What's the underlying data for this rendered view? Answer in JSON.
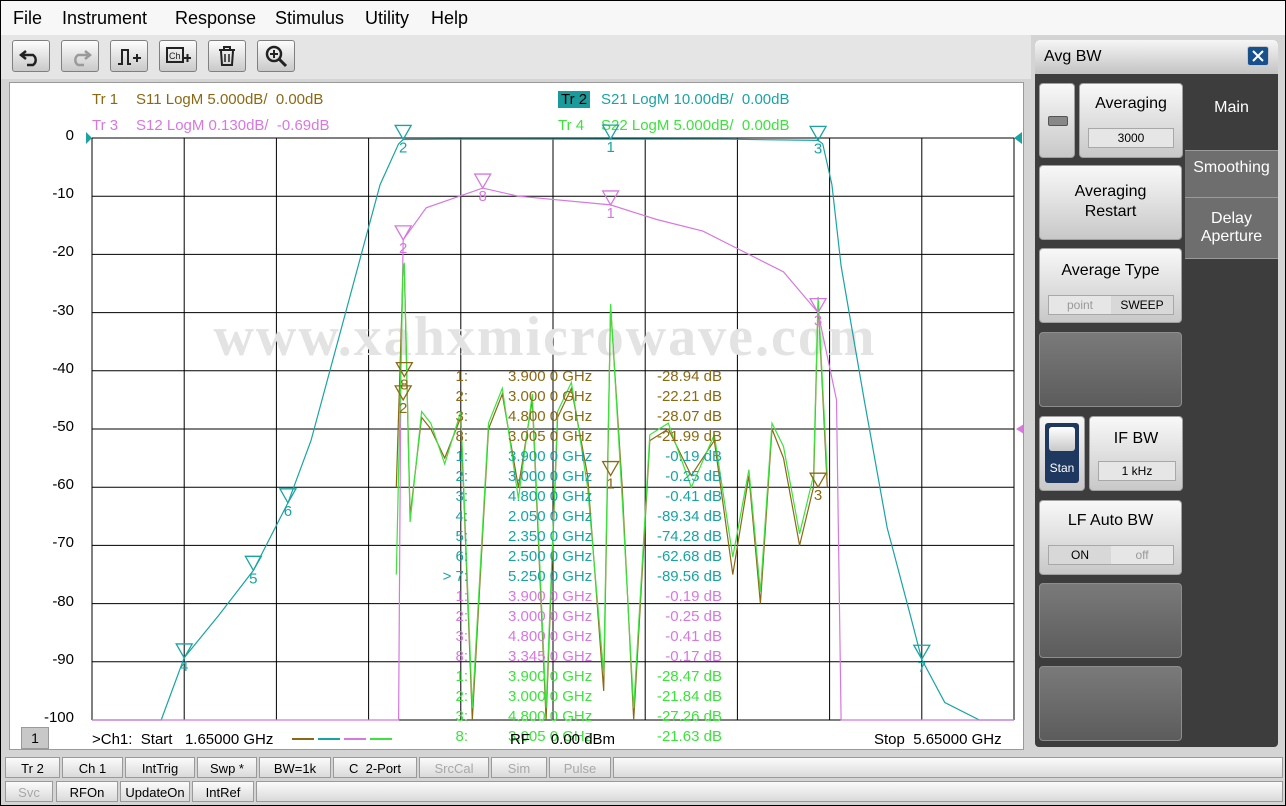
{
  "menu": [
    "File",
    "Instrument",
    "Response",
    "Stimulus",
    "Utility",
    "Help"
  ],
  "toolbar_icons": [
    "undo-icon",
    "redo-icon",
    "add-trace-icon",
    "add-channel-icon",
    "delete-icon",
    "zoom-icon"
  ],
  "traces": [
    {
      "tr": "Tr 1",
      "text": "S11 LogM 5.000dB/  0.00dB",
      "color": "#8b6914"
    },
    {
      "tr": "Tr 2",
      "text": "S21 LogM 10.00dB/  0.00dB",
      "color": "#1aa3a3",
      "active": true
    },
    {
      "tr": "Tr 3",
      "text": "S12 LogM 0.130dB/  -0.69dB",
      "color": "#d678e0"
    },
    {
      "tr": "Tr 4",
      "text": "S22 LogM 5.000dB/  0.00dB",
      "color": "#3de23d"
    }
  ],
  "y_ticks": [
    "0",
    "-10",
    "-20",
    "-30",
    "-40",
    "-50",
    "-60",
    "-70",
    "-80",
    "-90",
    "-100"
  ],
  "watermark": "www.xahxmicrowave.com",
  "marker_table": [
    {
      "n": "1:",
      "f": "3.900 0 GHz",
      "v": "-28.94 dB",
      "c": "#8b6914"
    },
    {
      "n": "2:",
      "f": "3.000 0 GHz",
      "v": "-22.21 dB",
      "c": "#8b6914"
    },
    {
      "n": "3:",
      "f": "4.800 0 GHz",
      "v": "-28.07 dB",
      "c": "#8b6914"
    },
    {
      "n": "8:",
      "f": "3.005 0 GHz",
      "v": "-21.99 dB",
      "c": "#8b6914"
    },
    {
      "n": "1:",
      "f": "3.900 0 GHz",
      "v": "-0.19 dB",
      "c": "#1aa3a3"
    },
    {
      "n": "2:",
      "f": "3.000 0 GHz",
      "v": "-0.25 dB",
      "c": "#1aa3a3"
    },
    {
      "n": "3:",
      "f": "4.800 0 GHz",
      "v": "-0.41 dB",
      "c": "#1aa3a3"
    },
    {
      "n": "4:",
      "f": "2.050 0 GHz",
      "v": "-89.34 dB",
      "c": "#1aa3a3"
    },
    {
      "n": "5:",
      "f": "2.350 0 GHz",
      "v": "-74.28 dB",
      "c": "#1aa3a3"
    },
    {
      "n": "6:",
      "f": "2.500 0 GHz",
      "v": "-62.68 dB",
      "c": "#1aa3a3"
    },
    {
      "n": "> 7:",
      "f": "5.250 0 GHz",
      "v": "-89.56 dB",
      "c": "#1aa3a3"
    },
    {
      "n": "1:",
      "f": "3.900 0 GHz",
      "v": "-0.19 dB",
      "c": "#d678e0"
    },
    {
      "n": "2:",
      "f": "3.000 0 GHz",
      "v": "-0.25 dB",
      "c": "#d678e0"
    },
    {
      "n": "3:",
      "f": "4.800 0 GHz",
      "v": "-0.41 dB",
      "c": "#d678e0"
    },
    {
      "n": "8:",
      "f": "3.345 0 GHz",
      "v": "-0.17 dB",
      "c": "#d678e0"
    },
    {
      "n": "1:",
      "f": "3.900 0 GHz",
      "v": "-28.47 dB",
      "c": "#3de23d"
    },
    {
      "n": "2:",
      "f": "3.000 0 GHz",
      "v": "-21.84 dB",
      "c": "#3de23d"
    },
    {
      "n": "3:",
      "f": "4.800 0 GHz",
      "v": "-27.26 dB",
      "c": "#3de23d"
    },
    {
      "n": "8:",
      "f": "3.005 0 GHz",
      "v": "-21.63 dB",
      "c": "#3de23d"
    }
  ],
  "footer": {
    "channel_number": "1",
    "start": ">Ch1:  Start   1.65000 GHz",
    "power": "RF     0.00 dBm",
    "stop": "Stop  5.65000 GHz"
  },
  "status_row1": [
    {
      "label": "Tr 2",
      "dim": false
    },
    {
      "label": "Ch 1",
      "dim": false
    },
    {
      "label": "IntTrig",
      "dim": false
    },
    {
      "label": "Swp *",
      "dim": false
    },
    {
      "label": "BW=1k",
      "dim": false
    },
    {
      "label": "C  2-Port",
      "dim": false
    },
    {
      "label": "SrcCal",
      "dim": true
    },
    {
      "label": "Sim",
      "dim": true
    },
    {
      "label": "Pulse",
      "dim": true
    }
  ],
  "status_row2": [
    {
      "label": "Svc",
      "dim": true
    },
    {
      "label": "RFOn",
      "dim": false
    },
    {
      "label": "UpdateOn",
      "dim": false
    },
    {
      "label": "IntRef",
      "dim": false
    }
  ],
  "softkeys": {
    "title": "Avg BW",
    "averaging_label": "Averaging",
    "averaging_value": "3000",
    "restart_label": "Averaging Restart",
    "avg_type_label": "Average Type",
    "avg_type_options": [
      "point",
      "SWEEP"
    ],
    "avg_type_selected": "SWEEP",
    "if_bw_label": "IF BW",
    "if_bw_value": "1 kHz",
    "stan_label": "Stan",
    "lf_auto_label": "LF Auto BW",
    "lf_auto_options": [
      "ON",
      "off"
    ],
    "lf_auto_selected": "ON",
    "tabs": [
      "Main",
      "Smoothing",
      "Delay Aperture"
    ],
    "active_tab": "Main"
  },
  "chart_data": {
    "type": "line",
    "xlim_ghz": [
      1.65,
      5.65
    ],
    "ylim": [
      -100,
      0
    ],
    "series": [
      {
        "name": "S21",
        "color": "#1aa3a3",
        "x": [
          1.65,
          1.95,
          2.05,
          2.2,
          2.35,
          2.5,
          2.6,
          2.75,
          2.9,
          2.98,
          3.0,
          3.2,
          3.5,
          3.9,
          4.4,
          4.8,
          4.82,
          4.86,
          4.9,
          5.0,
          5.1,
          5.2,
          5.25,
          5.35,
          5.5,
          5.65
        ],
        "y": [
          -100,
          -100,
          -89.3,
          -82,
          -74.3,
          -62.7,
          -52,
          -30,
          -8,
          -1,
          -0.25,
          -0.2,
          -0.2,
          -0.19,
          -0.2,
          -0.41,
          -1,
          -8,
          -22,
          -45,
          -67,
          -82,
          -89.6,
          -97,
          -100,
          -100
        ]
      },
      {
        "name": "S12",
        "color": "#d678e0",
        "x": [
          1.65,
          2.98,
          2.99,
          3.0,
          3.1,
          3.345,
          3.5,
          3.9,
          4.1,
          4.3,
          4.5,
          4.65,
          4.8,
          4.88,
          4.9,
          5.65
        ],
        "y": [
          -100,
          -100,
          -40,
          -17.5,
          -12,
          -8.6,
          -10,
          -11.5,
          -14,
          -16,
          -20,
          -23,
          -30,
          -45,
          -100,
          -100
        ]
      },
      {
        "name": "S11",
        "color": "#8b6914",
        "x": [
          2.97,
          3.0,
          3.005,
          3.03,
          3.08,
          3.12,
          3.18,
          3.25,
          3.3,
          3.37,
          3.43,
          3.5,
          3.56,
          3.62,
          3.67,
          3.73,
          3.8,
          3.87,
          3.9,
          3.95,
          4.0,
          4.07,
          4.15,
          4.25,
          4.35,
          4.43,
          4.5,
          4.55,
          4.6,
          4.65,
          4.72,
          4.78,
          4.8,
          4.84
        ],
        "y": [
          -60,
          -22.2,
          -22,
          -65,
          -48,
          -50,
          -55,
          -48,
          -100,
          -50,
          -44,
          -60,
          -45,
          -100,
          -48,
          -43,
          -58,
          -95,
          -28.9,
          -60,
          -100,
          -52,
          -50,
          -58,
          -52,
          -75,
          -58,
          -80,
          -50,
          -55,
          -70,
          -60,
          -28.1,
          -60
        ]
      },
      {
        "name": "S22",
        "color": "#3de23d",
        "x": [
          2.97,
          3.0,
          3.005,
          3.03,
          3.08,
          3.12,
          3.18,
          3.25,
          3.3,
          3.37,
          3.43,
          3.5,
          3.56,
          3.62,
          3.67,
          3.73,
          3.8,
          3.87,
          3.9,
          3.95,
          4.0,
          4.07,
          4.15,
          4.25,
          4.35,
          4.43,
          4.5,
          4.55,
          4.6,
          4.65,
          4.72,
          4.78,
          4.8,
          4.84
        ],
        "y": [
          -75,
          -21.8,
          -21.6,
          -66,
          -47,
          -49,
          -56,
          -47,
          -98,
          -49,
          -43,
          -62,
          -44,
          -98,
          -47,
          -42,
          -60,
          -92,
          -28.5,
          -62,
          -98,
          -51,
          -49,
          -60,
          -51,
          -72,
          -57,
          -78,
          -49,
          -53,
          -68,
          -58,
          -27.3,
          -58
        ]
      }
    ],
    "markers": [
      {
        "t": "S21",
        "label": "1",
        "x": 3.9,
        "y": -0.19,
        "color": "#1aa3a3"
      },
      {
        "t": "S21",
        "label": "2",
        "x": 3.0,
        "y": -0.25,
        "color": "#1aa3a3"
      },
      {
        "t": "S21",
        "label": "3",
        "x": 4.8,
        "y": -0.41,
        "color": "#1aa3a3"
      },
      {
        "t": "S21",
        "label": "4",
        "x": 2.05,
        "y": -89.34,
        "color": "#1aa3a3"
      },
      {
        "t": "S21",
        "label": "5",
        "x": 2.35,
        "y": -74.28,
        "color": "#1aa3a3"
      },
      {
        "t": "S21",
        "label": "6",
        "x": 2.5,
        "y": -62.68,
        "color": "#1aa3a3"
      },
      {
        "t": "S21",
        "label": "7",
        "x": 5.25,
        "y": -89.56,
        "color": "#1aa3a3"
      },
      {
        "t": "S12",
        "label": "1",
        "x": 3.9,
        "y": -11.5,
        "color": "#d678e0"
      },
      {
        "t": "S12",
        "label": "2",
        "x": 3.0,
        "y": -17.5,
        "color": "#d678e0"
      },
      {
        "t": "S12",
        "label": "3",
        "x": 4.8,
        "y": -30,
        "color": "#d678e0"
      },
      {
        "t": "S12",
        "label": "8",
        "x": 3.345,
        "y": -8.6,
        "color": "#d678e0"
      },
      {
        "t": "S11",
        "label": "1",
        "x": 3.9,
        "y": -58,
        "color": "#8b6914"
      },
      {
        "t": "S11",
        "label": "2",
        "x": 3.0,
        "y": -45,
        "color": "#8b6914"
      },
      {
        "t": "S11",
        "label": "3",
        "x": 4.8,
        "y": -60,
        "color": "#8b6914"
      },
      {
        "t": "S11",
        "label": "8",
        "x": 3.005,
        "y": -41,
        "color": "#8b6914"
      }
    ]
  }
}
